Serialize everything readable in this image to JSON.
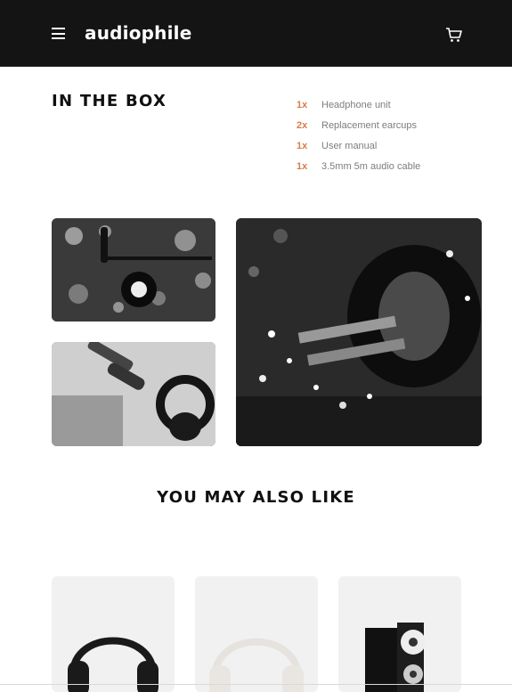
{
  "header": {
    "logo": "audiophile",
    "menu_icon": "hamburger-menu-icon",
    "cart_icon": "cart-icon"
  },
  "in_the_box": {
    "title": "IN THE BOX",
    "items": [
      {
        "qty": "1x",
        "name": "Headphone unit"
      },
      {
        "qty": "2x",
        "name": "Replacement earcups"
      },
      {
        "qty": "1x",
        "name": "User manual"
      },
      {
        "qty": "1x",
        "name": "3.5mm 5m audio cable"
      }
    ]
  },
  "also_like": {
    "title": "YOU MAY ALSO LIKE"
  },
  "colors": {
    "accent": "#d87d4a",
    "header_bg": "#141414",
    "card_bg": "#f1f1f1"
  }
}
